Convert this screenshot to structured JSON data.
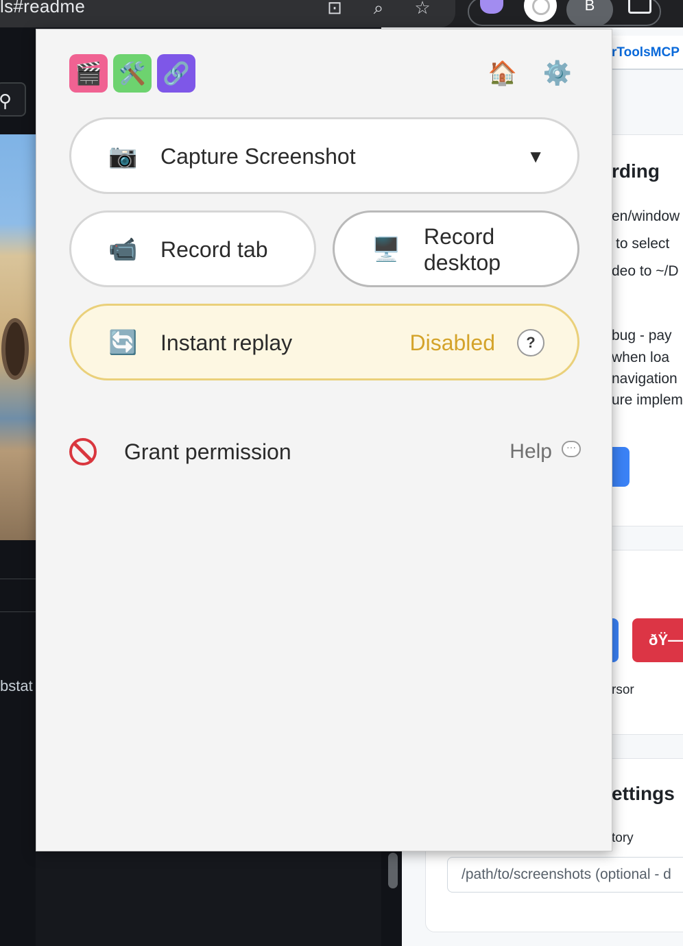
{
  "browser": {
    "url_fragment": "ls#readme"
  },
  "background": {
    "left_text": "bstat",
    "tab_label": "rToolsMCP",
    "heading_1": "rding",
    "lines_1": [
      "en/window",
      "to select",
      "deo to ~/D"
    ],
    "lines_2": [
      "bug - pay",
      "when loa",
      "navigation",
      "ure impleme"
    ],
    "cursor_text": "rsor",
    "red_button_label": "ðŸ—",
    "heading_2": "ettings",
    "directory_label": "tory",
    "path_placeholder": "/path/to/screenshots (optional - d"
  },
  "popup": {
    "header": {
      "icons": [
        "🎬",
        "🛠️",
        "🔗"
      ],
      "home_glyph": "🏠",
      "settings_glyph": "⚙️"
    },
    "capture": {
      "emoji": "📷",
      "label": "Capture Screenshot",
      "caret": "▼"
    },
    "record_tab": {
      "emoji": "📹",
      "label": "Record tab"
    },
    "record_desktop": {
      "emoji": "🖥️",
      "label_line1": "Record",
      "label_line2": "desktop"
    },
    "instant_replay": {
      "emoji": "🔄",
      "label": "Instant replay",
      "status": "Disabled",
      "help": "?"
    },
    "permission": {
      "label": "Grant permission",
      "help_label": "Help",
      "bubble": "···"
    }
  },
  "colors": {
    "replay_status": "#d4a32a",
    "replay_background": "#fdf7e2",
    "replay_border": "#ead07a",
    "permission_icon": "#d9363e"
  }
}
